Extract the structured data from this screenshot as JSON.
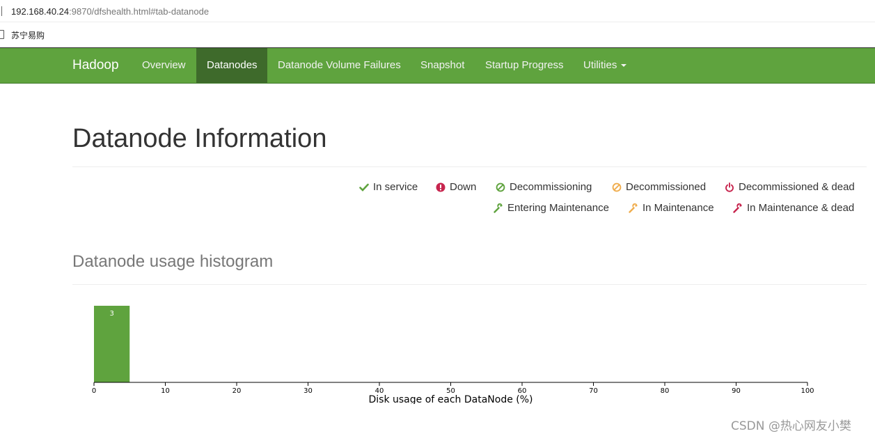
{
  "browser": {
    "url_host": "192.168.40.24",
    "url_path": ":9870/dfshealth.html#tab-datanode",
    "bookmarks": [
      {
        "label": "苏宁易购"
      }
    ]
  },
  "navbar": {
    "brand": "Hadoop",
    "items": [
      {
        "label": "Overview",
        "active": false
      },
      {
        "label": "Datanodes",
        "active": true
      },
      {
        "label": "Datanode Volume Failures",
        "active": false
      },
      {
        "label": "Snapshot",
        "active": false
      },
      {
        "label": "Startup Progress",
        "active": false
      },
      {
        "label": "Utilities",
        "active": false
      }
    ]
  },
  "page": {
    "title": "Datanode Information",
    "legend": [
      {
        "label": "In service",
        "icon": "check-icon",
        "color": "#5fa33e"
      },
      {
        "label": "Down",
        "icon": "exclamation-circle-icon",
        "color": "#c7254e"
      },
      {
        "label": "Decommissioning",
        "icon": "ban-icon",
        "color": "#5fa33e"
      },
      {
        "label": "Decommissioned",
        "icon": "ban-icon",
        "color": "#f0ad4e"
      },
      {
        "label": "Decommissioned & dead",
        "icon": "power-icon",
        "color": "#c7254e"
      },
      {
        "label": "Entering Maintenance",
        "icon": "wrench-icon",
        "color": "#5fa33e"
      },
      {
        "label": "In Maintenance",
        "icon": "wrench-icon",
        "color": "#f0ad4e"
      },
      {
        "label": "In Maintenance & dead",
        "icon": "wrench-icon",
        "color": "#c7254e"
      }
    ],
    "histogram_title": "Datanode usage histogram"
  },
  "chart_data": {
    "type": "bar",
    "bins": [
      {
        "x0": 0,
        "x1": 5,
        "count": 3
      }
    ],
    "xlim": [
      0,
      100
    ],
    "xticks": [
      0,
      10,
      20,
      30,
      40,
      50,
      60,
      70,
      80,
      90,
      100
    ],
    "xlabel": "Disk usage of each DataNode (%)",
    "bar_color": "#5fa33e",
    "grid": false
  },
  "watermark": "CSDN @热心网友小樊"
}
